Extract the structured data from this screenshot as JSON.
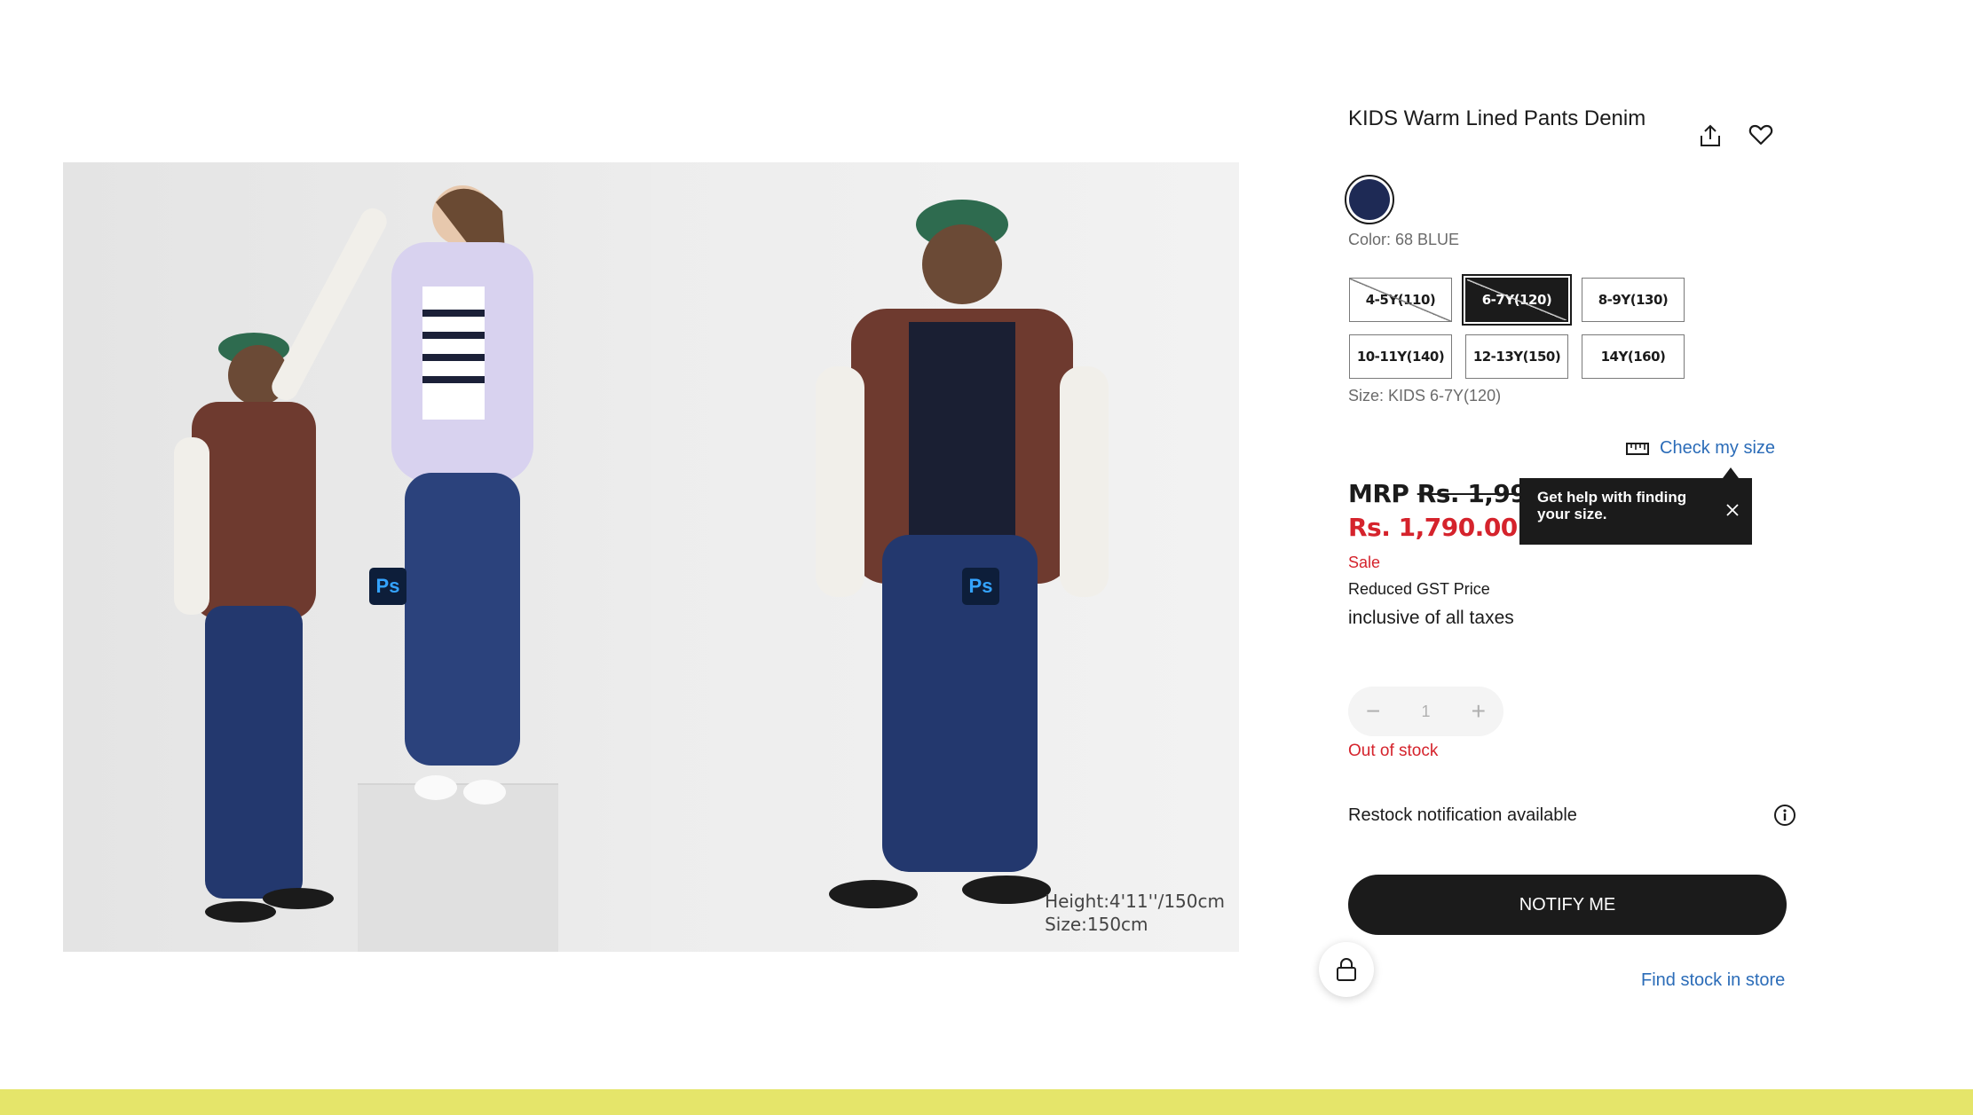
{
  "product": {
    "title": "KIDS Warm Lined Pants Denim",
    "image_caption_height": "Height:4'11''/150cm",
    "image_caption_size": "Size:150cm",
    "ps_badge": "Ps"
  },
  "actions": {
    "share_icon": "share-icon",
    "wishlist_icon": "heart-icon"
  },
  "color": {
    "label": "Color: 68 BLUE",
    "swatch_hex": "#1e2a55"
  },
  "sizes": {
    "options": [
      {
        "label": "4-5Y(110)",
        "available": false,
        "selected": false
      },
      {
        "label": "6-7Y(120)",
        "available": false,
        "selected": true
      },
      {
        "label": "8-9Y(130)",
        "available": true,
        "selected": false
      },
      {
        "label": "10-11Y(140)",
        "available": true,
        "selected": false
      },
      {
        "label": "12-13Y(150)",
        "available": true,
        "selected": false
      },
      {
        "label": "14Y(160)",
        "available": true,
        "selected": false
      }
    ],
    "selected_label": "Size: KIDS 6-7Y(120)",
    "check_size_link": "Check my size"
  },
  "tooltip": {
    "text": "Get help with finding your size."
  },
  "price": {
    "mrp_prefix": "MRP",
    "mrp_value": "Rs. 1,990.00",
    "sale_price": "Rs. 1,790.00",
    "sale_flag": "Sale",
    "gst_note": "Reduced GST Price",
    "tax_note": "inclusive of all taxes"
  },
  "quantity": {
    "value": "1",
    "minus": "−",
    "plus": "+"
  },
  "stock": {
    "status": "Out of stock",
    "restock": "Restock notification available"
  },
  "buttons": {
    "notify": "NOTIFY ME",
    "find_store": "Find stock in store"
  },
  "colors": {
    "accent_link": "#2b6cb8",
    "sale_red": "#d5232c",
    "footer_band": "#e5e56a"
  }
}
